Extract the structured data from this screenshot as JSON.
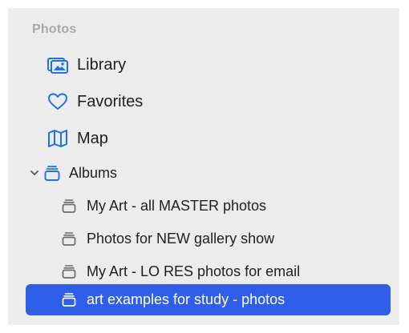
{
  "sidebar": {
    "section_title": "Photos",
    "items": [
      {
        "label": "Library",
        "icon": "library-icon"
      },
      {
        "label": "Favorites",
        "icon": "heart-icon"
      },
      {
        "label": "Map",
        "icon": "map-icon"
      }
    ],
    "albums": {
      "label": "Albums",
      "icon": "album-stack-icon",
      "expanded": true,
      "children": [
        {
          "label": "My Art - all MASTER photos",
          "icon": "album-icon",
          "selected": false
        },
        {
          "label": "Photos for NEW gallery show",
          "icon": "album-icon",
          "selected": false
        },
        {
          "label": "My Art - LO RES photos for email",
          "icon": "album-icon",
          "selected": false
        },
        {
          "label": "art examples for study - photos",
          "icon": "album-icon",
          "selected": true
        }
      ]
    }
  },
  "colors": {
    "accent_icon": "#1a73e8",
    "selection": "#2f5ee8",
    "section_header": "#a8a8a8",
    "sidebar_bg": "#ececec"
  }
}
